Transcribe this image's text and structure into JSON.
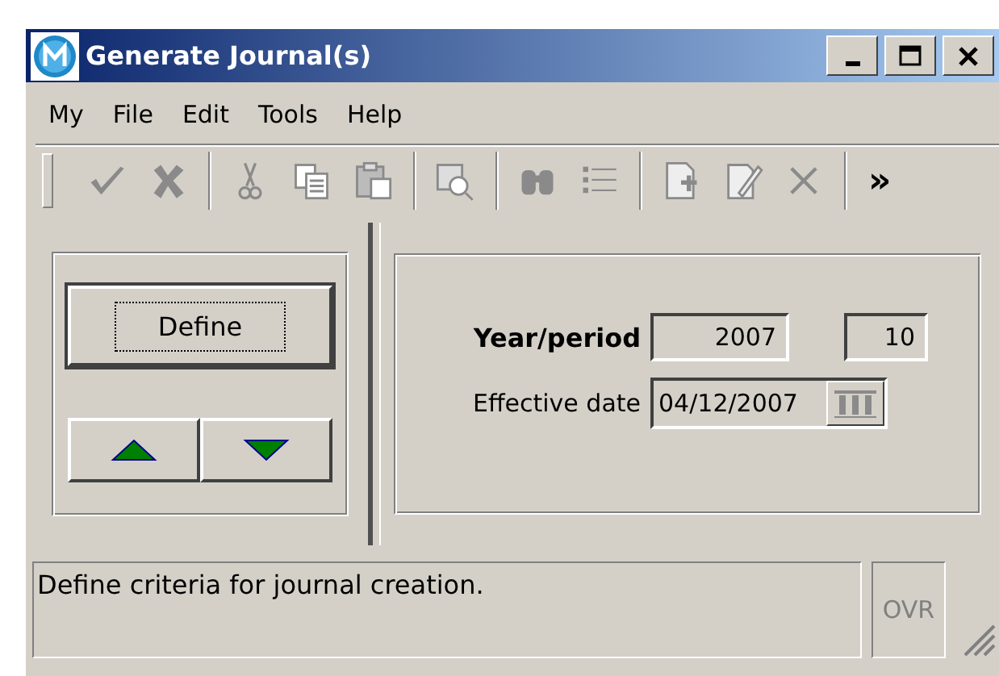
{
  "window": {
    "title": "Generate Journal(s)"
  },
  "menu": [
    {
      "label": "My"
    },
    {
      "label": "File"
    },
    {
      "label": "Edit"
    },
    {
      "label": "Tools"
    },
    {
      "label": "Help"
    }
  ],
  "toolbar": {
    "groups": [
      [
        {
          "kind": "check",
          "disabled": true
        },
        {
          "kind": "cross",
          "disabled": true
        }
      ],
      [
        {
          "kind": "cut",
          "disabled": true
        },
        {
          "kind": "copy",
          "disabled": true
        },
        {
          "kind": "paste",
          "disabled": true
        }
      ],
      [
        {
          "kind": "preview",
          "disabled": true
        }
      ],
      [
        {
          "kind": "find",
          "disabled": true
        },
        {
          "kind": "list",
          "disabled": true
        }
      ],
      [
        {
          "kind": "new",
          "disabled": true
        },
        {
          "kind": "edit",
          "disabled": true
        },
        {
          "kind": "delete",
          "disabled": true
        }
      ]
    ],
    "overflow": "»"
  },
  "actions": {
    "define": "Define",
    "up": {
      "disabled": false
    },
    "down": {
      "disabled": false
    }
  },
  "form": {
    "year_period_label": "Year/period",
    "year": "2007",
    "period": "10",
    "effective_date_label": "Effective date",
    "effective_date": "04/12/2007"
  },
  "status_bar": {
    "message": "Define criteria for journal creation.",
    "ovr": {
      "label": "OVR",
      "disabled": true
    }
  }
}
